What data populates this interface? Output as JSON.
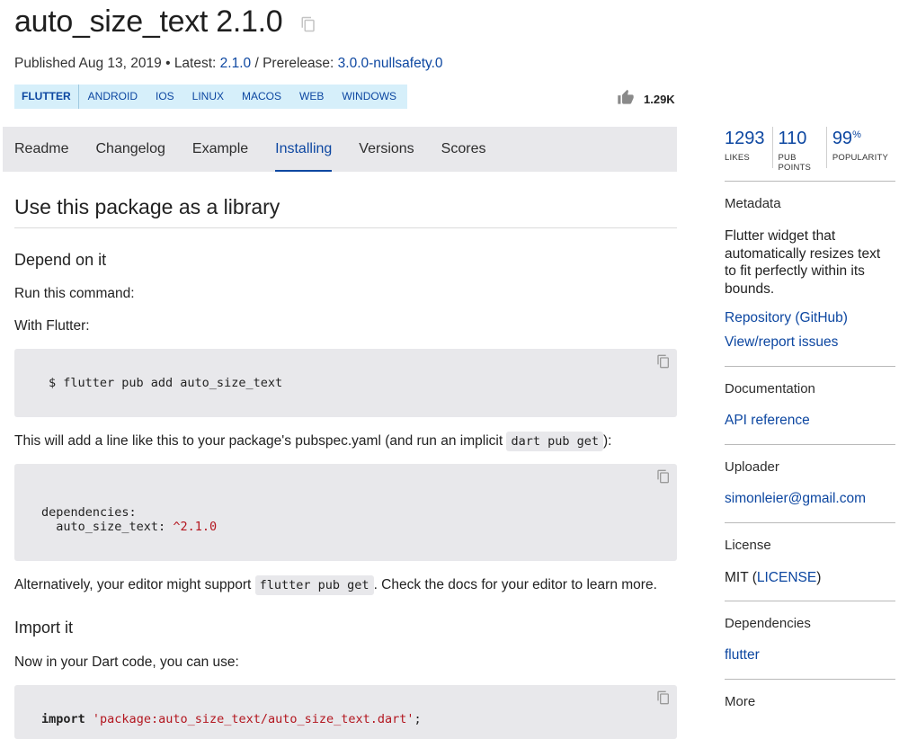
{
  "package": {
    "title": "auto_size_text 2.1.0",
    "published_prefix": "Published",
    "published_date": "Aug 13, 2019",
    "separator": " • ",
    "latest_prefix": "Latest:",
    "latest_version": "2.1.0",
    "slash": " / ",
    "prerelease_prefix": "Prerelease:",
    "prerelease_version": "3.0.0-nullsafety.0"
  },
  "platform_tags": [
    "FLUTTER",
    "ANDROID",
    "IOS",
    "LINUX",
    "MACOS",
    "WEB",
    "WINDOWS"
  ],
  "likes_badge": "1.29K",
  "tabs": [
    {
      "label": "Readme",
      "active": false
    },
    {
      "label": "Changelog",
      "active": false
    },
    {
      "label": "Example",
      "active": false
    },
    {
      "label": "Installing",
      "active": true
    },
    {
      "label": "Versions",
      "active": false
    },
    {
      "label": "Scores",
      "active": false
    }
  ],
  "content": {
    "heading": "Use this package as a library",
    "depend_heading": "Depend on it",
    "run_command": "Run this command:",
    "with_flutter": "With Flutter:",
    "cmd_code": "$ flutter pub add auto_size_text",
    "pubspec_before": "This will add a line like this to your package's pubspec.yaml (and run an implicit ",
    "pubspec_code": "dart pub get",
    "pubspec_after": "):",
    "yaml_line1": "dependencies:",
    "yaml_key": "  auto_size_text: ",
    "yaml_value": "^2.1.0",
    "alt_before": "Alternatively, your editor might support ",
    "alt_code": "flutter pub get",
    "alt_after": ". Check the docs for your editor to learn more.",
    "import_heading": "Import it",
    "dart_code_text": "Now in your Dart code, you can use:",
    "import_kw": "import",
    "import_str": "'package:auto_size_text/auto_size_text.dart'",
    "import_semi": ";"
  },
  "sidebar": {
    "stats": [
      {
        "value": "1293",
        "suffix": "",
        "label": "LIKES"
      },
      {
        "value": "110",
        "suffix": "",
        "label": "PUB POINTS"
      },
      {
        "value": "99",
        "suffix": "%",
        "label": "POPULARITY"
      }
    ],
    "metadata_heading": "Metadata",
    "description": "Flutter widget that automatically resizes text to fit perfectly within its bounds.",
    "repository_link": "Repository (GitHub)",
    "issues_link": "View/report issues",
    "documentation_heading": "Documentation",
    "api_link": "API reference",
    "uploader_heading": "Uploader",
    "uploader_email": "simonleier@gmail.com",
    "license_heading": "License",
    "license_text": "MIT (",
    "license_link": "LICENSE",
    "license_close": ")",
    "dependencies_heading": "Dependencies",
    "dependency": "flutter",
    "more_heading": "More"
  },
  "colors": {
    "link": "#0d47a1",
    "tag_bg": "#d6effa",
    "code_bg": "#e8e8eb",
    "string": "#b3161f"
  },
  "icons": [
    "copy-icon",
    "thumb-up-icon"
  ]
}
